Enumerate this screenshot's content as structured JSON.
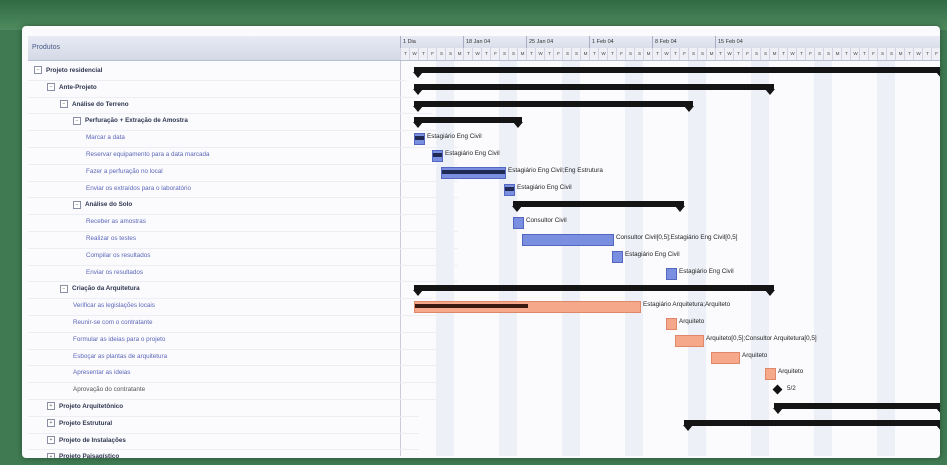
{
  "tree": {
    "header": "Produtos",
    "rows": [
      {
        "label": "Projeto residencial",
        "indent": 0,
        "kind": "summary",
        "exp": "−"
      },
      {
        "label": "Ante-Projeto",
        "indent": 1,
        "kind": "summary",
        "exp": "−"
      },
      {
        "label": "Análise do Terreno",
        "indent": 2,
        "kind": "summary",
        "exp": "−"
      },
      {
        "label": "Perfuração + Extração de Amostra",
        "indent": 3,
        "kind": "summary",
        "exp": "−"
      },
      {
        "label": "Marcar a data",
        "indent": 4,
        "kind": "task",
        "exp": ""
      },
      {
        "label": "Reservar equipamento para a data marcada",
        "indent": 4,
        "kind": "task",
        "exp": ""
      },
      {
        "label": "Fazer a perfuração no local",
        "indent": 4,
        "kind": "task",
        "exp": ""
      },
      {
        "label": "Enviar os extraídos para o laboratório",
        "indent": 4,
        "kind": "task",
        "exp": ""
      },
      {
        "label": "Análise do Solo",
        "indent": 3,
        "kind": "summary",
        "exp": "−"
      },
      {
        "label": "Receber as amostras",
        "indent": 4,
        "kind": "task",
        "exp": ""
      },
      {
        "label": "Realizar os testes",
        "indent": 4,
        "kind": "task",
        "exp": ""
      },
      {
        "label": "Compilar os resultados",
        "indent": 4,
        "kind": "task",
        "exp": ""
      },
      {
        "label": "Enviar os resultados",
        "indent": 4,
        "kind": "task",
        "exp": ""
      },
      {
        "label": "Criação da Arquitetura",
        "indent": 2,
        "kind": "summary",
        "exp": "−"
      },
      {
        "label": "Verificar as legislações locais",
        "indent": 3,
        "kind": "task",
        "exp": ""
      },
      {
        "label": "Reunir-se com o contratante",
        "indent": 3,
        "kind": "task",
        "exp": ""
      },
      {
        "label": "Formular as ideias para o projeto",
        "indent": 3,
        "kind": "task",
        "exp": ""
      },
      {
        "label": "Esboçar as plantas de arquitetura",
        "indent": 3,
        "kind": "task",
        "exp": ""
      },
      {
        "label": "Apresentar as ideias",
        "indent": 3,
        "kind": "task",
        "exp": ""
      },
      {
        "label": "Aprovação do contratante",
        "indent": 3,
        "kind": "plain",
        "exp": ""
      },
      {
        "label": "Projeto Arquitetônico",
        "indent": 1,
        "kind": "summary",
        "exp": "+"
      },
      {
        "label": "Projeto Estrutural",
        "indent": 1,
        "kind": "summary",
        "exp": "+"
      },
      {
        "label": "Projeto de Instalações",
        "indent": 1,
        "kind": "summary",
        "exp": "+"
      },
      {
        "label": "Projeto Paisagístico",
        "indent": 1,
        "kind": "summary",
        "exp": "+"
      }
    ]
  },
  "timeline": {
    "weeks": [
      "1 Dia",
      "18 Jan 04",
      "25 Jan 04",
      "1 Feb 04",
      "8 Feb 04",
      "15 Feb 04"
    ],
    "day_letters": [
      "T",
      "W",
      "T",
      "F",
      "S",
      "S",
      "M",
      "T",
      "W",
      "T",
      "F",
      "S",
      "S",
      "M",
      "T",
      "W",
      "T",
      "F",
      "S",
      "S",
      "M",
      "T",
      "W",
      "T",
      "F",
      "S",
      "S",
      "M",
      "T",
      "W",
      "T",
      "F",
      "S",
      "S",
      "M",
      "T",
      "W",
      "T",
      "F",
      "S",
      "S",
      "M",
      "T",
      "W",
      "T",
      "F",
      "S",
      "S",
      "M",
      "T",
      "W",
      "T",
      "F",
      "S",
      "S",
      "M",
      "T",
      "W",
      "T",
      "F"
    ]
  },
  "colors": {
    "task_blue": "#7b8fe0",
    "task_orange": "#f6a98a",
    "summary": "#141414",
    "progress": "#1f2a55"
  },
  "gantt": [
    {
      "row": 0,
      "type": "summary",
      "start": 1,
      "dur": 59,
      "label": ""
    },
    {
      "row": 1,
      "type": "summary",
      "start": 1,
      "dur": 40,
      "label": ""
    },
    {
      "row": 2,
      "type": "summary",
      "start": 1,
      "dur": 31,
      "label": ""
    },
    {
      "row": 3,
      "type": "summary",
      "start": 1,
      "dur": 12,
      "label": ""
    },
    {
      "row": 4,
      "type": "task",
      "color": "blue",
      "start": 1,
      "dur": 1,
      "progress": 1,
      "label": "Estagiário Eng Civil"
    },
    {
      "row": 5,
      "type": "task",
      "color": "blue",
      "start": 3,
      "dur": 1,
      "progress": 1,
      "label": "Estagiário Eng Civil"
    },
    {
      "row": 6,
      "type": "task",
      "color": "blue",
      "start": 4,
      "dur": 7,
      "progress": 1,
      "label": "Estagiário Eng Civil;Eng Estrutura"
    },
    {
      "row": 7,
      "type": "task",
      "color": "blue",
      "start": 11,
      "dur": 1,
      "progress": 1,
      "label": "Estagiário Eng Civil"
    },
    {
      "row": 8,
      "type": "summary",
      "start": 12,
      "dur": 19,
      "label": ""
    },
    {
      "row": 9,
      "type": "task",
      "color": "blue",
      "start": 12,
      "dur": 1,
      "progress": 0,
      "label": "Consultor Civil"
    },
    {
      "row": 10,
      "type": "task",
      "color": "blue",
      "start": 13,
      "dur": 10,
      "progress": 0,
      "label": "Consultor Civil[0,5];Estagiário Eng Civil[0,5]"
    },
    {
      "row": 11,
      "type": "task",
      "color": "blue",
      "start": 23,
      "dur": 1,
      "progress": 0,
      "label": "Estagiário Eng Civil"
    },
    {
      "row": 12,
      "type": "task",
      "color": "blue",
      "start": 29,
      "dur": 1,
      "progress": 0,
      "label": "Estagiário Eng Civil"
    },
    {
      "row": 13,
      "type": "summary",
      "start": 1,
      "dur": 40,
      "label": ""
    },
    {
      "row": 14,
      "type": "task",
      "color": "orange",
      "start": 1,
      "dur": 25,
      "progress": 0.5,
      "label": "Estagiário Arquitetura;Arquiteto"
    },
    {
      "row": 15,
      "type": "task",
      "color": "orange",
      "start": 29,
      "dur": 1,
      "progress": 0,
      "label": "Arquiteto"
    },
    {
      "row": 16,
      "type": "task",
      "color": "orange",
      "start": 30,
      "dur": 3,
      "progress": 0,
      "label": "Arquiteto[0,5];Consultor Arquitetura[0,5]"
    },
    {
      "row": 17,
      "type": "task",
      "color": "orange",
      "start": 34,
      "dur": 3,
      "progress": 0,
      "label": "Arquiteto"
    },
    {
      "row": 18,
      "type": "task",
      "color": "orange",
      "start": 40,
      "dur": 1,
      "progress": 0,
      "label": "Arquiteto"
    },
    {
      "row": 19,
      "type": "milestone",
      "start": 41,
      "label": "5/2"
    },
    {
      "row": 20,
      "type": "summary",
      "start": 41,
      "dur": 19,
      "label": ""
    },
    {
      "row": 21,
      "type": "summary",
      "start": 31,
      "dur": 29,
      "label": ""
    }
  ]
}
